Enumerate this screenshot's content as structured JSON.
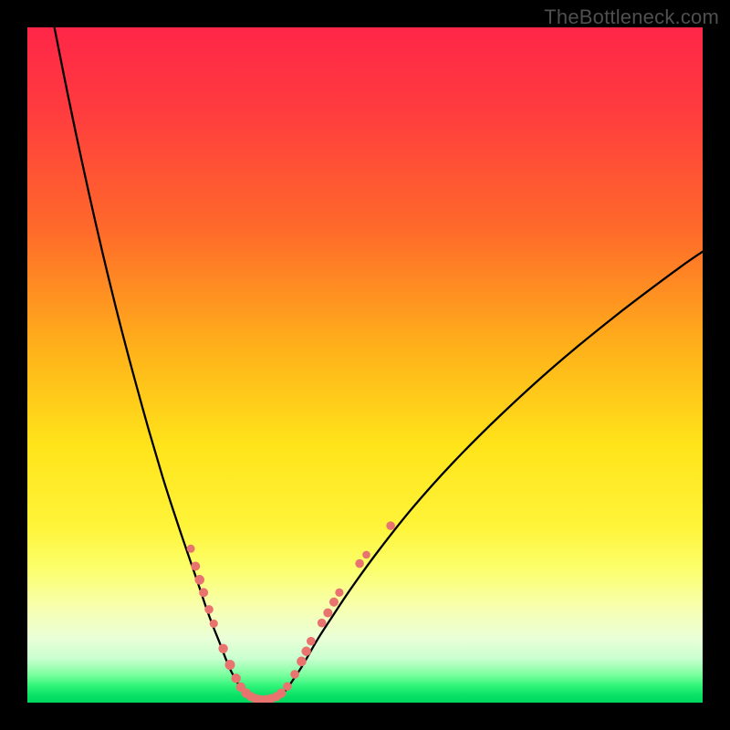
{
  "watermark": "TheBottleneck.com",
  "chart_data": {
    "type": "line",
    "title": "",
    "xlabel": "",
    "ylabel": "",
    "xlim": [
      0,
      100
    ],
    "ylim": [
      0,
      100
    ],
    "gradient_stops": [
      {
        "offset": 0.0,
        "color": "#ff2648"
      },
      {
        "offset": 0.12,
        "color": "#ff3b3f"
      },
      {
        "offset": 0.3,
        "color": "#ff6a2a"
      },
      {
        "offset": 0.48,
        "color": "#ffb31a"
      },
      {
        "offset": 0.62,
        "color": "#ffe41a"
      },
      {
        "offset": 0.74,
        "color": "#fff43a"
      },
      {
        "offset": 0.8,
        "color": "#fcff6a"
      },
      {
        "offset": 0.86,
        "color": "#f7ffb0"
      },
      {
        "offset": 0.905,
        "color": "#eaffd8"
      },
      {
        "offset": 0.935,
        "color": "#c9ffcf"
      },
      {
        "offset": 0.958,
        "color": "#7effa0"
      },
      {
        "offset": 0.975,
        "color": "#30f47a"
      },
      {
        "offset": 0.99,
        "color": "#07e165"
      },
      {
        "offset": 1.0,
        "color": "#00d85f"
      }
    ],
    "series": [
      {
        "name": "left-branch",
        "x": [
          4,
          6,
          8,
          10,
          12,
          14,
          16,
          18,
          20,
          21.5,
          23,
          24.3,
          25.5,
          26.5,
          27.5,
          28.5,
          29.3,
          30.0,
          30.8,
          31.6,
          32.5
        ],
        "y": [
          100,
          90,
          80.5,
          71.5,
          63,
          55,
          47.5,
          40.3,
          33.5,
          28.8,
          24.3,
          20.5,
          17.0,
          14.0,
          11.3,
          8.8,
          6.7,
          5.0,
          3.5,
          2.2,
          1.2
        ]
      },
      {
        "name": "valley-floor",
        "x": [
          32.5,
          33.3,
          34.2,
          35.0,
          35.9,
          36.8,
          37.7
        ],
        "y": [
          1.2,
          0.6,
          0.35,
          0.3,
          0.35,
          0.6,
          1.2
        ]
      },
      {
        "name": "right-branch",
        "x": [
          37.7,
          38.6,
          39.5,
          40.5,
          41.5,
          43,
          45,
          48,
          52,
          57,
          63,
          70,
          78,
          87,
          96,
          100
        ],
        "y": [
          1.2,
          2.3,
          3.6,
          5.1,
          6.8,
          9.4,
          12.5,
          17.0,
          22.5,
          28.8,
          35.5,
          42.5,
          49.8,
          57.2,
          64.0,
          66.8
        ]
      }
    ],
    "scatter_points": {
      "name": "sample-dots",
      "color": "#e9746f",
      "points": [
        {
          "x": 24.2,
          "y": 22.8,
          "r": 4.5
        },
        {
          "x": 24.9,
          "y": 20.2,
          "r": 5.0
        },
        {
          "x": 25.5,
          "y": 18.2,
          "r": 5.3
        },
        {
          "x": 26.1,
          "y": 16.3,
          "r": 5.0
        },
        {
          "x": 26.9,
          "y": 13.8,
          "r": 4.8
        },
        {
          "x": 27.6,
          "y": 11.7,
          "r": 4.6
        },
        {
          "x": 29.0,
          "y": 8.0,
          "r": 5.2
        },
        {
          "x": 30.0,
          "y": 5.6,
          "r": 5.5
        },
        {
          "x": 30.9,
          "y": 3.6,
          "r": 5.2
        },
        {
          "x": 31.6,
          "y": 2.3,
          "r": 5.2
        },
        {
          "x": 32.4,
          "y": 1.4,
          "r": 5.3
        },
        {
          "x": 33.1,
          "y": 0.9,
          "r": 5.0
        },
        {
          "x": 33.8,
          "y": 0.6,
          "r": 5.0
        },
        {
          "x": 34.5,
          "y": 0.45,
          "r": 5.0
        },
        {
          "x": 35.3,
          "y": 0.45,
          "r": 5.0
        },
        {
          "x": 36.1,
          "y": 0.6,
          "r": 5.0
        },
        {
          "x": 36.9,
          "y": 0.9,
          "r": 5.0
        },
        {
          "x": 37.6,
          "y": 1.4,
          "r": 5.2
        },
        {
          "x": 38.5,
          "y": 2.4,
          "r": 4.8
        },
        {
          "x": 39.6,
          "y": 4.2,
          "r": 4.8
        },
        {
          "x": 40.6,
          "y": 6.1,
          "r": 5.3
        },
        {
          "x": 41.3,
          "y": 7.6,
          "r": 5.2
        },
        {
          "x": 42.0,
          "y": 9.1,
          "r": 4.8
        },
        {
          "x": 43.6,
          "y": 11.8,
          "r": 4.8
        },
        {
          "x": 44.5,
          "y": 13.3,
          "r": 5.0
        },
        {
          "x": 45.4,
          "y": 14.9,
          "r": 5.0
        },
        {
          "x": 46.2,
          "y": 16.3,
          "r": 4.6
        },
        {
          "x": 49.2,
          "y": 20.6,
          "r": 4.8
        },
        {
          "x": 50.2,
          "y": 21.9,
          "r": 4.3
        },
        {
          "x": 53.8,
          "y": 26.2,
          "r": 4.8
        }
      ]
    }
  }
}
